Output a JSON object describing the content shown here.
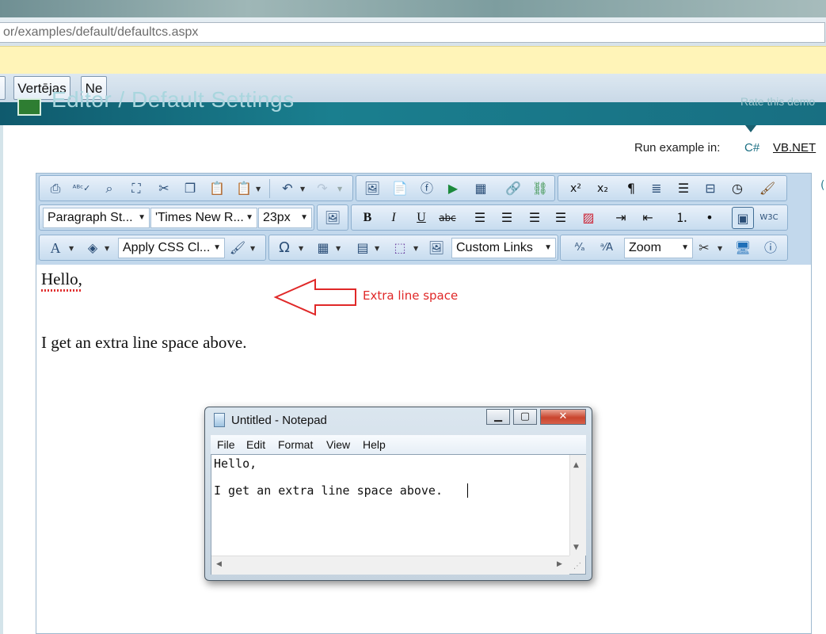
{
  "browser": {
    "url": "or/examples/default/defaultcs.aspx",
    "buttons": [
      "Vertējas",
      "Ne"
    ]
  },
  "site": {
    "title": "Editor / Default Settings",
    "rate_text": "Rate this demo",
    "run_example_label": "Run example in:",
    "lang_options": [
      "C#",
      "VB.NET"
    ]
  },
  "editor": {
    "toolbar": {
      "paragraph_style": "Paragraph St...",
      "font_name": "'Times New R...",
      "font_size": "23px",
      "apply_css": "Apply CSS Cl...",
      "custom_links": "Custom Links",
      "zoom": "Zoom"
    },
    "content": {
      "line1": "Hello,",
      "line2": "I get an extra line space above."
    },
    "annotation": {
      "text": "Extra line space",
      "color": "#e02828"
    }
  },
  "notepad": {
    "title": "Untitled - Notepad",
    "menu": [
      "File",
      "Edit",
      "Format",
      "View",
      "Help"
    ],
    "lines": [
      "Hello,",
      "I get an extra line space above."
    ]
  }
}
